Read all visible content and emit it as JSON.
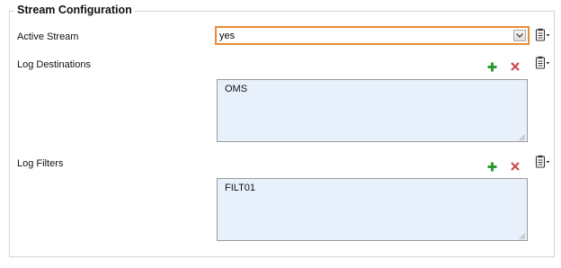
{
  "section": {
    "title": "Stream Configuration"
  },
  "active_stream": {
    "label": "Active Stream",
    "value": "yes"
  },
  "log_destinations": {
    "label": "Log Destinations",
    "items": [
      "OMS"
    ]
  },
  "log_filters": {
    "label": "Log Filters",
    "items": [
      "FILT01"
    ]
  },
  "colors": {
    "accent": "#e98b34",
    "list_bg": "#e8f1fb",
    "add": "#2e9b2e",
    "remove": "#d04a4a"
  }
}
